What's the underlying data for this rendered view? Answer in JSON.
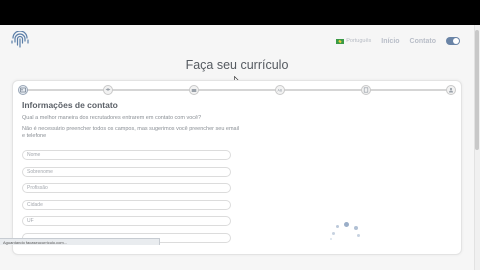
{
  "header": {
    "language": "Português",
    "nav": [
      {
        "label": "Início"
      },
      {
        "label": "Contato"
      }
    ]
  },
  "page_title": "Faça seu currículo",
  "steps": [
    {
      "icon": "contact-card-icon",
      "active": true
    },
    {
      "icon": "education-icon",
      "active": false
    },
    {
      "icon": "briefcase-icon",
      "active": false
    },
    {
      "icon": "language-icon",
      "active": false
    },
    {
      "icon": "document-icon",
      "active": false
    },
    {
      "icon": "user-icon",
      "active": false
    }
  ],
  "section": {
    "title": "Informações de contato",
    "question": "Qual a melhor maneira dos recrutadores entrarem em contato com você?",
    "hint": "Não é necessário preencher todos os campos, mas sugerimos você preencher seu email e telefone"
  },
  "fields": [
    {
      "placeholder": "Nome"
    },
    {
      "placeholder": "Sobrenome"
    },
    {
      "placeholder": "Profissão"
    },
    {
      "placeholder": "Cidade"
    },
    {
      "placeholder": "UF"
    },
    {
      "placeholder": ""
    }
  ],
  "status_bar": "Aguardando facaseucurriculo.com...",
  "colors": {
    "accent": "#6a84a6",
    "background": "#f6f6f6",
    "title": "#555a60"
  }
}
